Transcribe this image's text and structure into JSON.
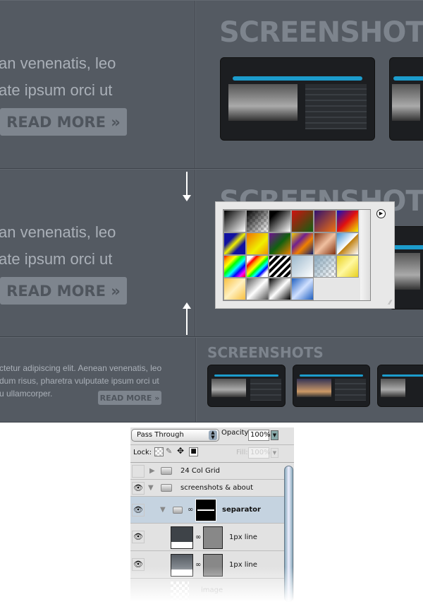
{
  "sections": [
    {
      "line1": "an venenatis, leo",
      "line2": "ate ipsum orci ut",
      "button": "READ MORE »",
      "heading": "SCREENSHOTS"
    },
    {
      "line1": "an venenatis, leo",
      "line2": "ate ipsum orci ut",
      "button": "READ MORE »",
      "heading": "SCREENSHOTS"
    },
    {
      "line1": "ctetur adipiscing elit. Aenean venenatis, leo",
      "line2": "dum risus, pharetra vulputate ipsum orci ut",
      "line3": "u ullamcorper.",
      "button": "READ MORE »",
      "heading": "SCREENSHOTS"
    }
  ],
  "gradient_picker": {
    "menu_icon": "play-circle-icon",
    "swatches": [
      "linear-gradient(135deg,#000,#fff)",
      "linear-gradient(135deg,#000,rgba(255,255,255,0)),repeating-conic-gradient(#ccc 0 25%,#fff 0 50%) 0 0/8px 8px",
      "linear-gradient(135deg,#000 20%,#fff)",
      "linear-gradient(135deg,#d01010,#106010)",
      "linear-gradient(135deg,#301070,#f07010)",
      "linear-gradient(135deg,#1010c0,#e01010 50%,#f0f000)",
      "linear-gradient(135deg,#1010a0 30%,#f0f000 50%,#1010a0 70%)",
      "linear-gradient(135deg,#f07000,#f0f000 60%,#f09000)",
      "linear-gradient(135deg,#701090,#106010 50%,#f08000)",
      "linear-gradient(135deg,#f0d000,#702090 35%,#f08000 60%,#102070)",
      "linear-gradient(135deg,#803010,#f0c0a0 50%,#803010)",
      "linear-gradient(135deg,#4090d0,#fff 50%,#c08010 52%,#fff)",
      "linear-gradient(135deg,red,orange,yellow,lime,cyan,blue,magenta,red)",
      "linear-gradient(135deg,#fff 15%,red,orange,yellow,lime,cyan,blue,#fff 85%)",
      "repeating-linear-gradient(135deg,#000 0 4px,#fff 4px 7px)",
      "linear-gradient(135deg,#9cb8cc,#fff)",
      "linear-gradient(135deg,#8aa8bc,rgba(255,255,255,0)),repeating-conic-gradient(#ccc 0 25%,#fff 0 50%) 0 0/8px 8px",
      "linear-gradient(135deg,#e8d020,#fff8a0 50%,#e8d020)",
      "linear-gradient(135deg,#f8c040,#fff0c0 50%,#f8c040)",
      "linear-gradient(135deg,#555,#fff 50%,#555)",
      "linear-gradient(135deg,#000,#fff 50%,#000)",
      "linear-gradient(135deg,#2060c0,#d0e0ff 50%,#2060c0)"
    ]
  },
  "layers": {
    "blend_mode": "Pass Through",
    "opacity_label": "Opacity:",
    "opacity": "100%",
    "lock_label": "Lock:",
    "fill_label": "Fill:",
    "fill": "100%",
    "rows": [
      {
        "name": "24 Col Grid",
        "visible": false,
        "type": "group",
        "expanded": false
      },
      {
        "name": "screenshots & about",
        "visible": true,
        "type": "group",
        "expanded": true
      },
      {
        "name": "separator",
        "visible": true,
        "type": "group",
        "expanded": true,
        "selected": true
      },
      {
        "name": "1px line",
        "visible": true,
        "type": "layer"
      },
      {
        "name": "1px line",
        "visible": true,
        "type": "layer"
      },
      {
        "name": "image",
        "visible": true,
        "type": "layer"
      }
    ]
  },
  "colors": {
    "page_bg": "#545a62",
    "selected_row": "#c5d3e0",
    "accent": "#1c9ccc"
  }
}
